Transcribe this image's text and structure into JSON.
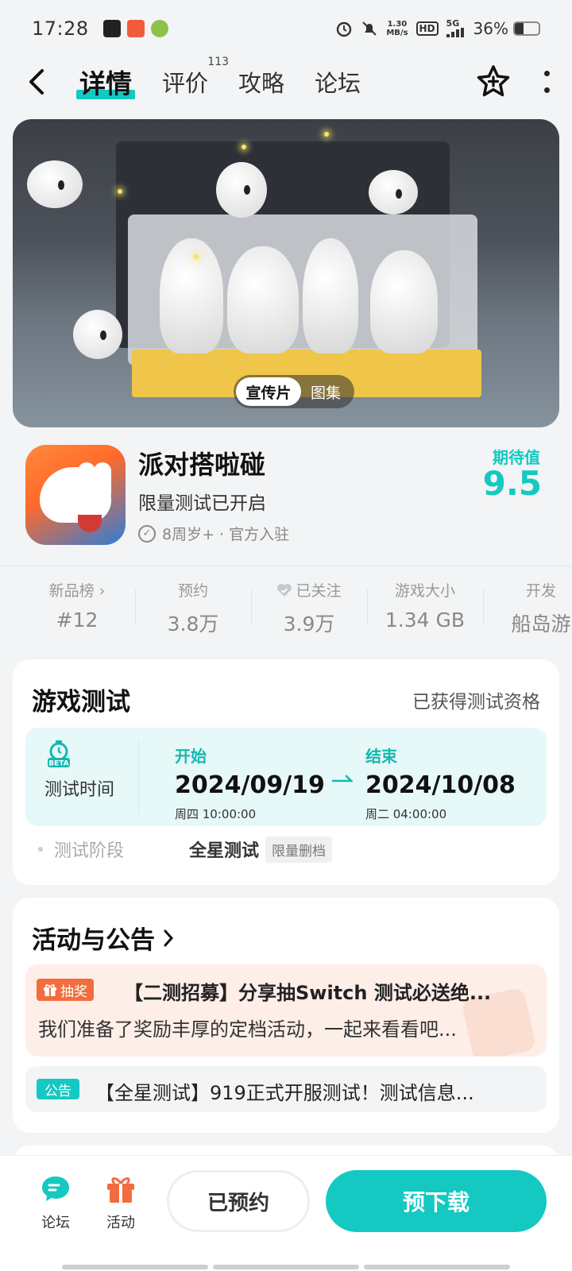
{
  "status_bar": {
    "time": "17:28",
    "network_speed_value": "1.30",
    "network_speed_unit": "MB/s",
    "hd_label": "HD",
    "signal_label": "5G",
    "battery_percent": "36%",
    "battery_level": 0.36
  },
  "nav": {
    "tabs": [
      {
        "label": "详情",
        "active": true
      },
      {
        "label": "评价",
        "badge": "113"
      },
      {
        "label": "攻略"
      },
      {
        "label": "论坛"
      }
    ]
  },
  "banner": {
    "media_tabs": [
      "宣传片",
      "图集"
    ],
    "selected_media_tab": "宣传片"
  },
  "game": {
    "name": "派对搭啦碰",
    "subtitle": "限量测试已开启",
    "meta": "8周岁+ · 官方入驻",
    "expectation_label": "期待值",
    "expectation_score": "9.5"
  },
  "stats": [
    {
      "label": "新品榜 ›",
      "value": "#12"
    },
    {
      "label": "预约",
      "value": "3.8万"
    },
    {
      "label": "已关注",
      "value": "3.9万"
    },
    {
      "label": "游戏大小",
      "value": "1.34 GB"
    },
    {
      "label": "开发",
      "value": "船岛游"
    }
  ],
  "game_test": {
    "title": "游戏测试",
    "status": "已获得测试资格",
    "time_label": "测试时间",
    "start_label": "开始",
    "start_date": "2024/09/19",
    "start_sub": "周四  10:00:00",
    "end_label": "结束",
    "end_date": "2024/10/08",
    "end_sub": "周二  04:00:00",
    "stage_label": "测试阶段",
    "stage_value": "全星测试",
    "stage_tag": "限量删档"
  },
  "events": {
    "title": "活动与公告",
    "items": [
      {
        "tag": "抽奖",
        "title": "【二测招募】分享抽Switch 测试必送绝...",
        "desc": "我们准备了奖励丰厚的定档活动，一起来看看吧..."
      },
      {
        "tag": "公告",
        "title": "【全星测试】919正式开服测试！测试信息..."
      }
    ]
  },
  "bottom_bar": {
    "forum_label": "论坛",
    "activity_label": "活动",
    "reserved_label": "已预约",
    "predownload_label": "预下载"
  },
  "colors": {
    "accent": "#14c9c1",
    "lottery": "#f26d3d",
    "background": "#f2f4f5"
  }
}
